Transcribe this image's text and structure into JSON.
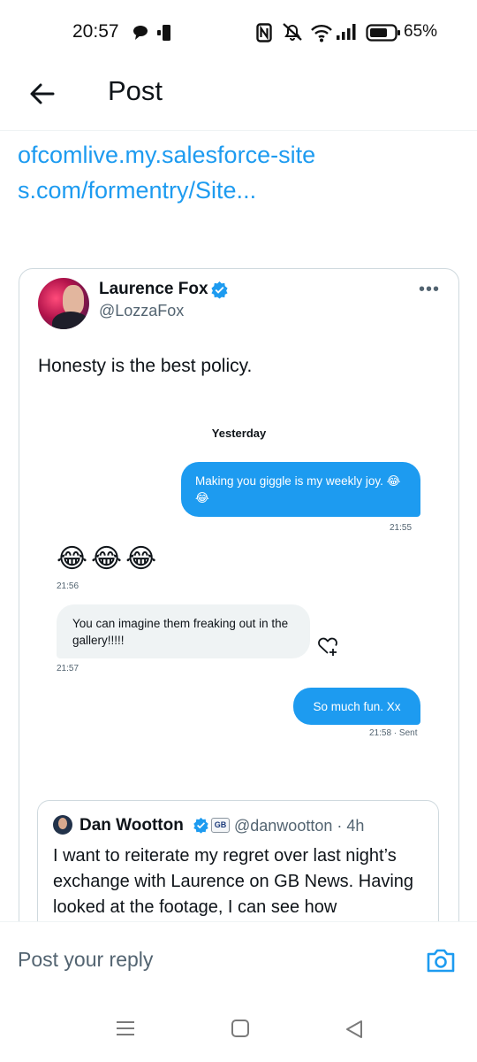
{
  "status_bar": {
    "time": "20:57",
    "battery_percent": "65%",
    "icons": [
      "chat-bubble-icon",
      "notification-icon",
      "nfc-icon",
      "mute-icon",
      "wifi-icon",
      "signal-icon",
      "battery-icon"
    ]
  },
  "header": {
    "back_icon": "arrow-left-icon",
    "title": "Post"
  },
  "post": {
    "link_text": "ofcomlive.my.salesforce-sites.com/formentry/Site..."
  },
  "card": {
    "author_name": "Laurence Fox",
    "author_handle": "@LozzaFox",
    "more": "•••",
    "text": "Honesty is the best policy.",
    "dm": {
      "day": "Yesterday",
      "messages": [
        {
          "dir": "out",
          "text": "Making you giggle is my weekly joy. 😂😂",
          "time": "21:55"
        },
        {
          "dir": "in",
          "text": "😂😂😂",
          "time": "21:56"
        },
        {
          "dir": "in",
          "text": "You can imagine them freaking out in the gallery!!!!!",
          "time": "21:57"
        },
        {
          "dir": "out",
          "text": "So much fun. Xx",
          "time": "21:58 · Sent"
        }
      ]
    },
    "quote": {
      "name": "Dan Wootton",
      "badge": "GB",
      "handle_time": "@danwootton · 4h",
      "text": "I want to reiterate my regret over last night’s exchange with Laurence on GB News. Having looked at the footage, I can see how inappropriate my reaction to his totally"
    }
  },
  "reply": {
    "placeholder": "Post your reply",
    "camera_icon": "camera-icon"
  },
  "nav": {
    "icons": [
      "menu-icon",
      "home-icon",
      "back-triangle-icon"
    ]
  },
  "colors": {
    "accent": "#1d9bf0",
    "text": "#0f1419",
    "secondary": "#536471",
    "border": "#cfd9de"
  }
}
